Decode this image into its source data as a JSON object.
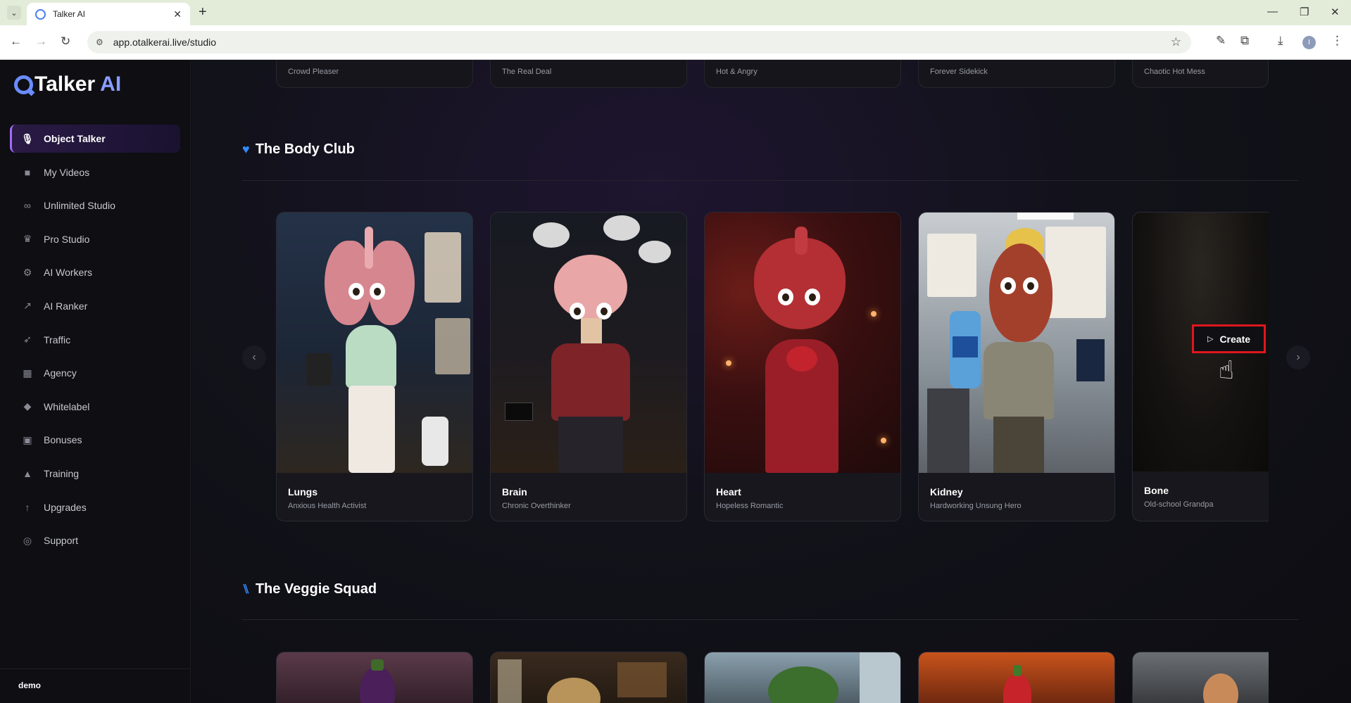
{
  "browser": {
    "tab_title": "Talker AI",
    "url": "app.otalkerai.live/studio"
  },
  "brand": {
    "name": "Talker",
    "suffix": "AI"
  },
  "sidebar": {
    "items": [
      {
        "label": "Object Talker",
        "icon": "microphone-icon",
        "active": true
      },
      {
        "label": "My Videos",
        "icon": "video-camera-icon"
      },
      {
        "label": "Unlimited Studio",
        "icon": "infinity-icon"
      },
      {
        "label": "Pro Studio",
        "icon": "crown-icon"
      },
      {
        "label": "AI Workers",
        "icon": "robot-icon"
      },
      {
        "label": "AI Ranker",
        "icon": "chart-line-icon"
      },
      {
        "label": "Traffic",
        "icon": "rocket-icon"
      },
      {
        "label": "Agency",
        "icon": "building-icon"
      },
      {
        "label": "Whitelabel",
        "icon": "tag-icon"
      },
      {
        "label": "Bonuses",
        "icon": "gift-icon"
      },
      {
        "label": "Training",
        "icon": "graduation-cap-icon"
      },
      {
        "label": "Upgrades",
        "icon": "arrow-up-icon"
      },
      {
        "label": "Support",
        "icon": "headset-icon"
      }
    ],
    "user": "demo"
  },
  "previous_row": [
    "Crowd Pleaser",
    "The Real Deal",
    "Hot & Angry",
    "Forever Sidekick",
    "Chaotic Hot Mess"
  ],
  "body_club": {
    "title": "The Body Club",
    "icon": "heart-pulse-icon",
    "cards": [
      {
        "name": "Lungs",
        "subtitle": "Anxious Health Activist"
      },
      {
        "name": "Brain",
        "subtitle": "Chronic Overthinker"
      },
      {
        "name": "Heart",
        "subtitle": "Hopeless Romantic"
      },
      {
        "name": "Kidney",
        "subtitle": "Hardworking Unsung Hero"
      },
      {
        "name": "Bone",
        "subtitle": "Old-school Grandpa"
      }
    ],
    "create_label": "Create"
  },
  "veggie_squad": {
    "title": "The Veggie Squad",
    "icon": "utensils-icon"
  },
  "colors": {
    "accent": "#a36bff",
    "section_icon": "#2f8cff",
    "highlight_box": "#e0161d"
  }
}
